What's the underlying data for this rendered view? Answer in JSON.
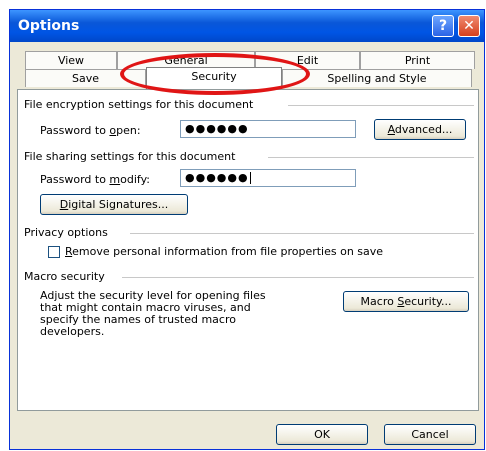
{
  "window": {
    "title": "Options"
  },
  "title_buttons": {
    "help": "?",
    "close": "✕"
  },
  "tabs": {
    "row1": [
      "View",
      "General",
      "Edit",
      "Print"
    ],
    "row2": [
      "Save",
      "Security",
      "Spelling and Style"
    ],
    "active": "Security"
  },
  "encryption": {
    "group_label": "File encryption settings for this document",
    "password_label_pre": "Password to ",
    "password_label_key": "o",
    "password_label_post": "pen:",
    "password_value": "●●●●●●",
    "advanced_pre": "",
    "advanced_key": "A",
    "advanced_post": "dvanced..."
  },
  "sharing": {
    "group_label": "File sharing settings for this document",
    "password_label_pre": "Password to ",
    "password_label_key": "m",
    "password_label_post": "odify:",
    "password_value": "●●●●●●",
    "signatures_pre": "",
    "signatures_key": "D",
    "signatures_post": "igital Signatures..."
  },
  "privacy": {
    "group_label": "Privacy options",
    "checkbox_pre": "",
    "checkbox_key": "R",
    "checkbox_post": "emove personal information from file properties on save",
    "checked": false
  },
  "macro": {
    "group_label": "Macro security",
    "description": "Adjust the security level for opening files\nthat might contain macro viruses, and\nspecify the names of trusted macro\ndevelopers.",
    "button_pre": "Macro ",
    "button_key": "S",
    "button_post": "ecurity..."
  },
  "footer": {
    "ok": "OK",
    "cancel": "Cancel"
  },
  "colors": {
    "highlight_ring": "#e01515",
    "titlebar": "#0055e5"
  }
}
